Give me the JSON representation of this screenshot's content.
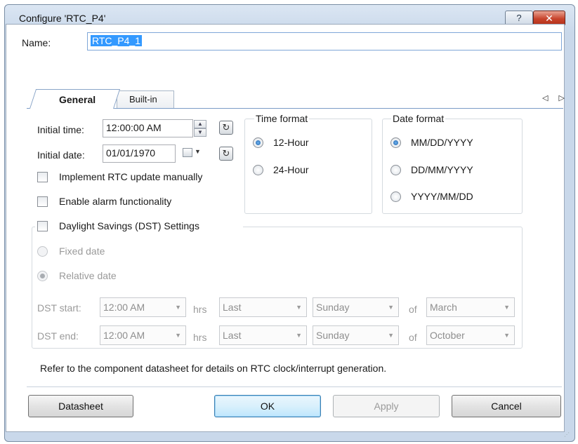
{
  "window": {
    "title": "Configure 'RTC_P4'",
    "help_glyph": "?",
    "close_glyph": "✕"
  },
  "name_field": {
    "label": "Name:",
    "value": "RTC_P4_1"
  },
  "tabs": [
    {
      "label": "General",
      "active": true
    },
    {
      "label": "Built-in",
      "active": false
    }
  ],
  "tab_scroll_glyphs": "◁ ▷",
  "initial_time": {
    "label": "Initial time:",
    "value": "12:00:00 AM"
  },
  "initial_date": {
    "label": "Initial date:",
    "value": "01/01/1970"
  },
  "checkboxes": {
    "rtc_manual": {
      "label": "Implement RTC update manually",
      "checked": false
    },
    "alarm": {
      "label": "Enable alarm functionality",
      "checked": false
    },
    "dst": {
      "label": "Daylight Savings (DST) Settings",
      "checked": false
    }
  },
  "time_format": {
    "title": "Time format",
    "options": [
      {
        "label": "12-Hour",
        "selected": true
      },
      {
        "label": "24-Hour",
        "selected": false
      }
    ]
  },
  "date_format": {
    "title": "Date format",
    "options": [
      {
        "label": "MM/DD/YYYY",
        "selected": true
      },
      {
        "label": "DD/MM/YYYY",
        "selected": false
      },
      {
        "label": "YYYY/MM/DD",
        "selected": false
      }
    ]
  },
  "dst": {
    "fixed_label": "Fixed date",
    "relative_label": "Relative date",
    "start": {
      "label": "DST start:",
      "time": "12:00 AM",
      "hrs": "hrs",
      "week": "Last",
      "day": "Sunday",
      "of": "of",
      "month": "March"
    },
    "end": {
      "label": "DST end:",
      "time": "12:00 AM",
      "hrs": "hrs",
      "week": "Last",
      "day": "Sunday",
      "of": "of",
      "month": "October"
    }
  },
  "info_text": "Refer to the component datasheet for details on RTC clock/interrupt generation.",
  "buttons": {
    "datasheet": "Datasheet",
    "ok": "OK",
    "apply": "Apply",
    "cancel": "Cancel"
  },
  "colors": {
    "selection": "#3399ff",
    "title_bar": "#c9d8ea",
    "close": "#c7432b"
  }
}
